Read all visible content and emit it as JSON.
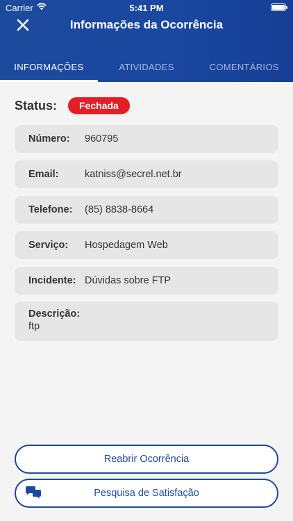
{
  "status_bar": {
    "carrier": "Carrier",
    "time": "5:41 PM"
  },
  "header": {
    "title": "Informações da Ocorrência",
    "close_icon": "close-icon"
  },
  "tabs": [
    {
      "label": "INFORMAÇÕES",
      "active": true
    },
    {
      "label": "ATIVIDADES",
      "active": false
    },
    {
      "label": "COMENTÁRIOS",
      "active": false
    }
  ],
  "status": {
    "label": "Status:",
    "value": "Fechada",
    "color": "#e31e24"
  },
  "fields": [
    {
      "key": "Número:",
      "value": "960795"
    },
    {
      "key": "Email:",
      "value": "katniss@secrel.net.br"
    },
    {
      "key": "Telefone:",
      "value": "(85) 8838-8664"
    },
    {
      "key": "Serviço:",
      "value": "Hospedagem Web"
    },
    {
      "key": "Incidente:",
      "value": "Dúvidas sobre FTP"
    }
  ],
  "description": {
    "key": "Descrição:",
    "value": "ftp"
  },
  "buttons": {
    "reopen": "Reabrir Ocorrência",
    "survey": "Pesquisa de Satisfação",
    "survey_icon": "chat-bubbles-icon"
  },
  "colors": {
    "primary": "#1c4a9c",
    "status_closed": "#e31e24",
    "card_bg": "#e6e6e6"
  }
}
